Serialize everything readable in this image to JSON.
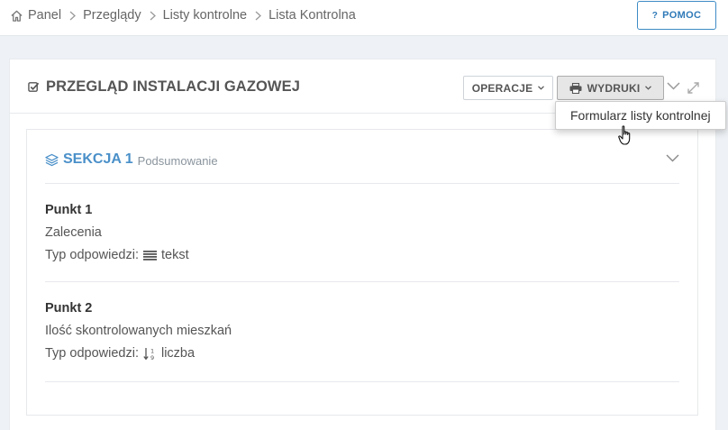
{
  "breadcrumb": {
    "items": [
      "Panel",
      "Przeglądy",
      "Listy kontrolne",
      "Lista Kontrolna"
    ]
  },
  "help": {
    "label": "POMOC"
  },
  "panel": {
    "title": "PRZEGLĄD INSTALACJI GAZOWEJ",
    "operations_label": "OPERACJE",
    "prints_label": "WYDRUKI",
    "dropdown_items": [
      "Formularz listy kontrolnej"
    ]
  },
  "section": {
    "name": "SEKCJA 1",
    "subtitle": "Podsumowanie",
    "items": [
      {
        "title": "Punkt 1",
        "description": "Zalecenia",
        "type_label": "Typ odpowiedzi:",
        "type_value": "tekst",
        "type_icon": "text-lines-icon"
      },
      {
        "title": "Punkt 2",
        "description": "Ilość skontrolowanych mieszkań",
        "type_label": "Typ odpowiedzi:",
        "type_value": "liczba",
        "type_icon": "numeric-sort-icon"
      }
    ]
  },
  "colors": {
    "accent": "#4a90c9",
    "help_border": "#3d8bc5"
  }
}
